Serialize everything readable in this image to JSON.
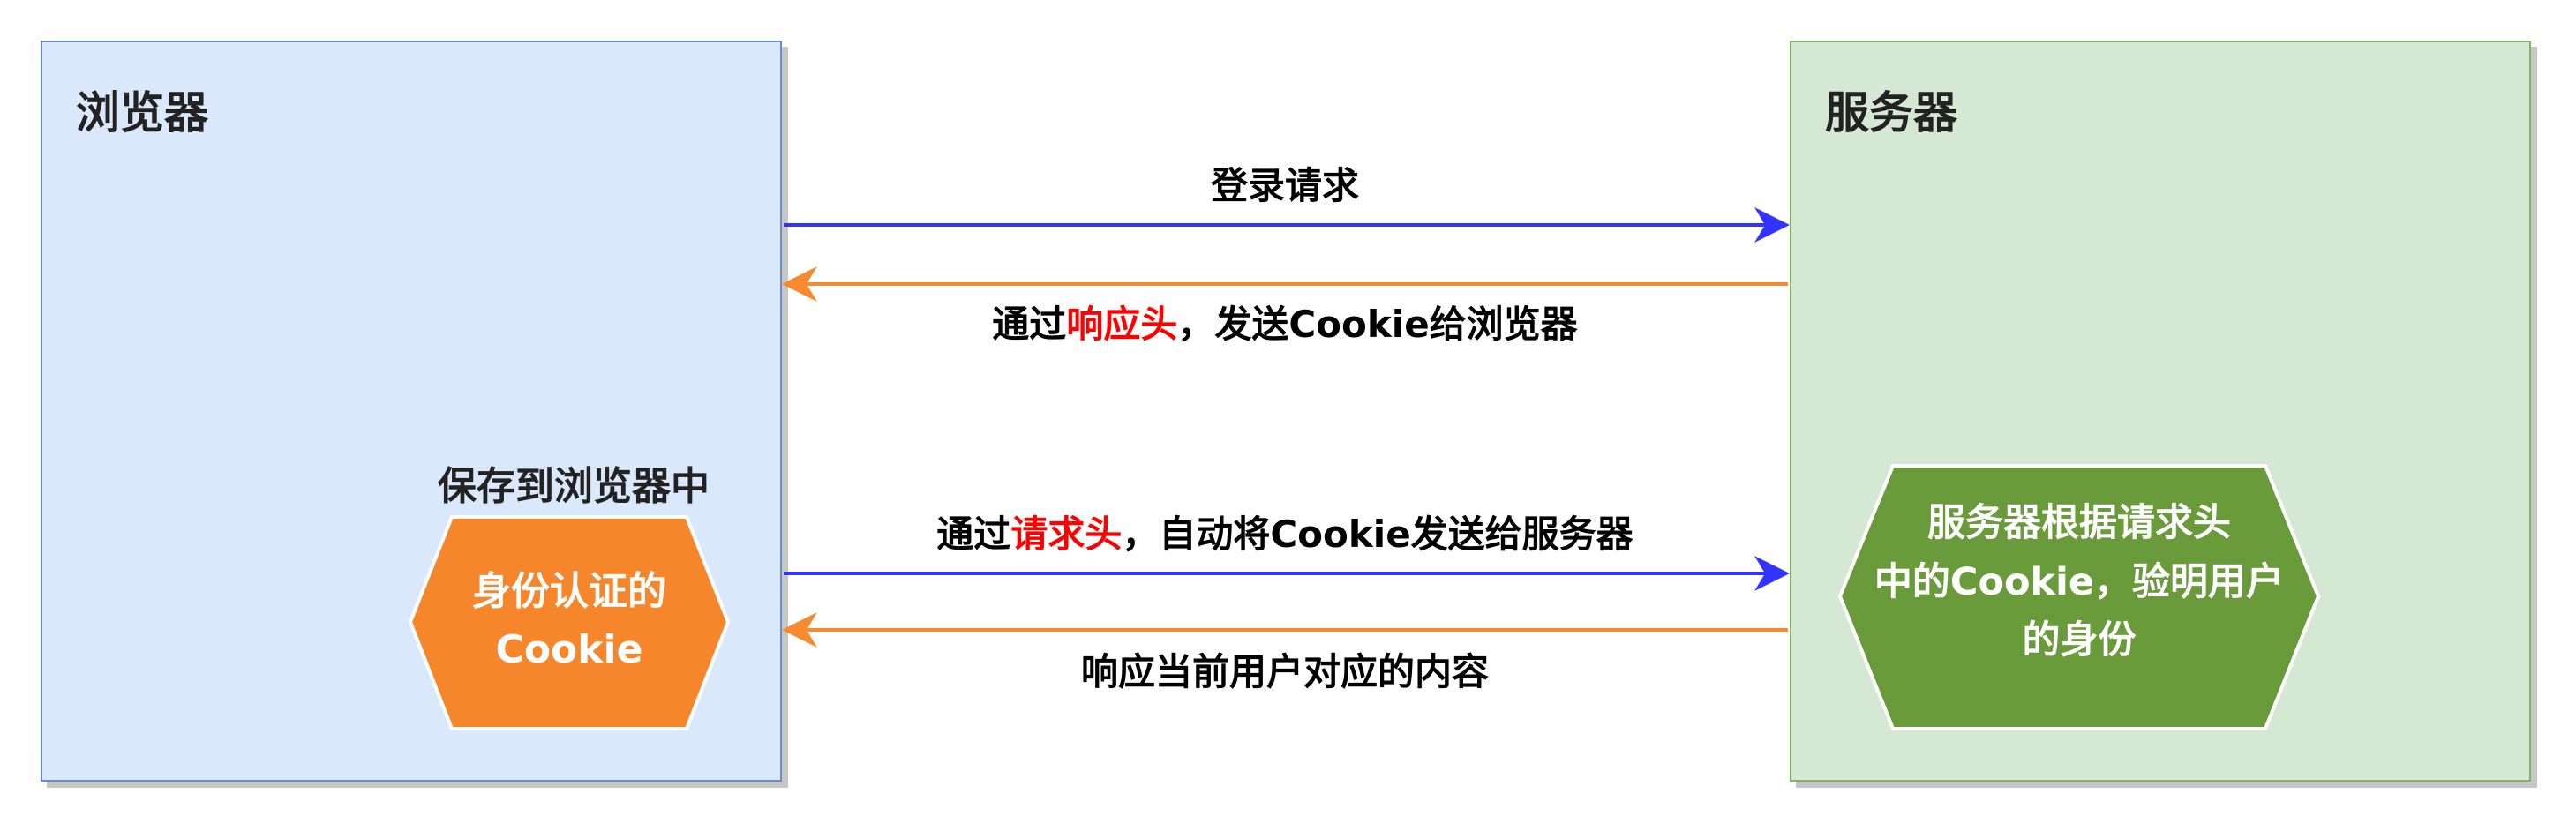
{
  "browser": {
    "title": "浏览器",
    "store_label": "保存到浏览器中",
    "cookie_line1": "身份认证的",
    "cookie_line2": "Cookie"
  },
  "server": {
    "title": "服务器",
    "verify_line1": "服务器根据请求头",
    "verify_line2": "中的Cookie，验明用户",
    "verify_line3": "的身份"
  },
  "arrows": {
    "login_request": "登录请求",
    "set_cookie_prefix": "通过",
    "set_cookie_highlight": "响应头",
    "set_cookie_suffix": "，发送Cookie给浏览器",
    "send_cookie_prefix": "通过",
    "send_cookie_highlight": "请求头",
    "send_cookie_suffix": "，自动将Cookie发送给服务器",
    "response_content": "响应当前用户对应的内容"
  },
  "colors": {
    "browser_fill": "#dae8fc",
    "browser_border": "#6c8ebf",
    "server_fill": "#d5e8d4",
    "server_border": "#82b366",
    "request_arrow": "#3333ff",
    "response_arrow": "#f58a2e",
    "cookie_hexagon": "#f5862c",
    "verify_hexagon": "#6a9b3b",
    "highlight_text": "#ff0000"
  }
}
